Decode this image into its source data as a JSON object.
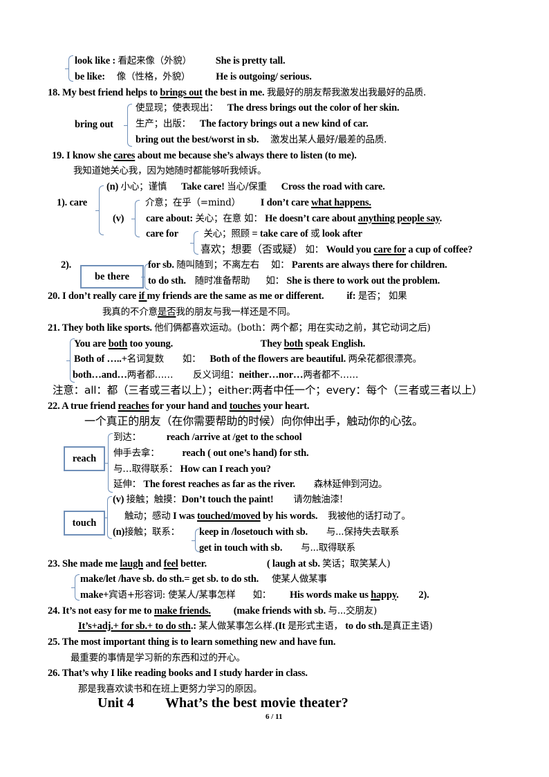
{
  "lines": {
    "l1a": "look like :",
    "l1b": "看起来像（外貌）",
    "l1c": "She is pretty tall.",
    "l2a": "be like:",
    "l2b": "像（性格，外貌）",
    "l2c": "He is outgoing/ serious.",
    "s18a": "18. My best friend helps to ",
    "s18u": "brings out",
    "s18b": " the best in me.",
    "s18cn": "我最好的朋友帮我激发出我最好的品质.",
    "bo_label": "bring out",
    "bo1cn": "使显现；使表现出：",
    "bo1en": "The dress brings out the color of her skin.",
    "bo2cn": "生产；出版：",
    "bo2en": "The factory brings out a new kind of car.",
    "bo3en": "bring out the best/worst in sb.",
    "bo3cn": "激发出某人最好/最差的品质.",
    "s19a": "19. I know she ",
    "s19u": "cares",
    "s19b": " about me because she’s always there to listen  (to me).",
    "s19cn": "我知道她关心我，因为她随时都能够听我倾诉。",
    "care_label": "1). care",
    "care_n": "(n)",
    "care_ncn": "小心；谨慎",
    "care_nen1": "Take care!",
    "care_ncn2": "当心/保重",
    "care_nen2": "Cross the road with care.",
    "care_v": "(v)",
    "care_v1cn": "介意；在乎（=mind）",
    "care_v1en": "I don’t care ",
    "care_v1u": "what happens.",
    "care_v2a": "care about:",
    "care_v2cn": "关心；在意  如：",
    "care_v2en": "He doesn’t care about ",
    "care_v2u": "anything people say",
    "care_v2end": ".",
    "care_v3a": "care for",
    "care_v3cn": "关心；照顾",
    "care_v3en": "= take care of",
    "care_v3or": "或",
    "care_v3en2": "look after",
    "care_v4cn": "喜欢；想要（否或疑）",
    "care_v4ru": "如：",
    "care_v4en": "Would you ",
    "care_v4u": "care for",
    "care_v4end": " a cup of coffee?",
    "bt_num": "2).",
    "bt_label": "be there",
    "bt1en": "for sb.",
    "bt1cn": "随叫随到；不离左右",
    "bt1ru": "如：",
    "bt1ex": "Parents are always there for children.",
    "bt2en": "to do sth.",
    "bt2cn": "随时准备帮助",
    "bt2ru": "如：",
    "bt2ex": "She is there to work out the problem.",
    "s20a": "20.   I don’t really care ",
    "s20u": "if ",
    "s20b": "my friends are the same as me or different.",
    "s20if": "if:",
    "s20ifcn": "是否；  如果",
    "s20cn_a": "我真的不介意",
    "s20cn_u": "是否",
    "s20cn_b": "我的朋友与我一样还是不同。",
    "s21a": "21. They both like sports.",
    "s21cn": "他们俩都喜欢运动。(both：两个都；用在实动之前，其它动词之后)",
    "b1a": "You are ",
    "b1u": "both",
    "b1b": " too young.",
    "b1c": "They ",
    "b1d": "both",
    "b1e": " speak English.",
    "b2a": "Both of …..+",
    "b2cn": "名词复数",
    "b2ru": "如：",
    "b2en": "Both of the flowers are beautiful.",
    "b2cn2": "两朵花都很漂亮。",
    "b3a": "both…and…",
    "b3cn": "两者都……",
    "b3cn2": "反义词组：",
    "b3en": "neither…nor…",
    "b3cn3": "两者都不……",
    "note": "注意：all：都（三者或三者以上）；either:两者中任一个；every：每个（三者或三者以上）",
    "s22a": "22. A true friend ",
    "s22u1": "reaches",
    "s22b": " for your hand and ",
    "s22u2": "touches",
    "s22c": " your heart.",
    "s22cn": "一个真正的朋友（在你需要帮助的时候）向你伸出手，触动你的心弦。",
    "reach_label": "reach",
    "r1cn": "到达：",
    "r1en": "reach /arrive at /get to the school",
    "r2cn": "伸手去拿：",
    "r2en": "reach ( out one’s hand) for sth.",
    "r3cn": "与…取得联系：",
    "r3en": "How can I reach you?",
    "r4cn": "延伸：",
    "r4en": "The forest reaches as far as the river.",
    "r4cn2": "森林延伸到河边。",
    "touch_label": "touch",
    "t1a": "(v)",
    "t1cn": "接触；触摸：",
    "t1en": "Don’t touch the paint!",
    "t1cn2": "请勿触油漆!",
    "t2cn": "触动；感动",
    "t2en": "I was ",
    "t2u": "touched/moved",
    "t2b": " by his words.",
    "t2cn2": "我被他的话打动了。",
    "t3a": "(n)",
    "t3cn": "接触；联系：",
    "t3en": "keep in /losetouch with sb.",
    "t3cn2": "与...保持失去联系",
    "t4en": "get in touch with sb.",
    "t4cn": "与...取得联系",
    "s23a": "23. She made me ",
    "s23u1": "laugh",
    "s23b": " and ",
    "s23u2": "feel",
    "s23c": " better.",
    "s23d": "(    laugh at sb.",
    "s23cn": "笑话；取笑某人)",
    "m1en": "make/let /have sb. do sth.= get sb. to do sth.",
    "m1cn": "使某人做某事",
    "m2a": "make+",
    "m2cn": "宾语+形容词: 使某人/某事怎样",
    "m2ru": "如：",
    "m2en": "His words make us ",
    "m2u": "happy",
    "m2end": ".",
    "m2num": "2).",
    "s24a": "24. It’s not easy for me to ",
    "s24u": "make friends.",
    "s24b": "(make friends with  sb.",
    "s24cn": "与...交朋友)",
    "s24pu": "It’s+adj.+ for sb.+ to do sth",
    "s24pa": ".:",
    "s24pcn": "某人做某事怎么样.",
    "s24pb": "(It",
    "s24pcn2": "是形式主语，",
    "s24pc": "to do sth.",
    "s24pcn3": "是真正主语)",
    "s25": "25. The most important thing is to learn something new and have fun.",
    "s25cn": "最重要的事情是学习新的东西和过的开心。",
    "s26": "26.    That’s why I like reading books and I study harder in class.",
    "s26cn": "那是我喜欢读书和在班上更努力学习的原因。",
    "unit": "Unit 4",
    "unit_title": "What’s the best movie theater?",
    "page": "6  /  11"
  },
  "colors": {
    "bracket": "#6f8fb8",
    "text": "#000000"
  }
}
